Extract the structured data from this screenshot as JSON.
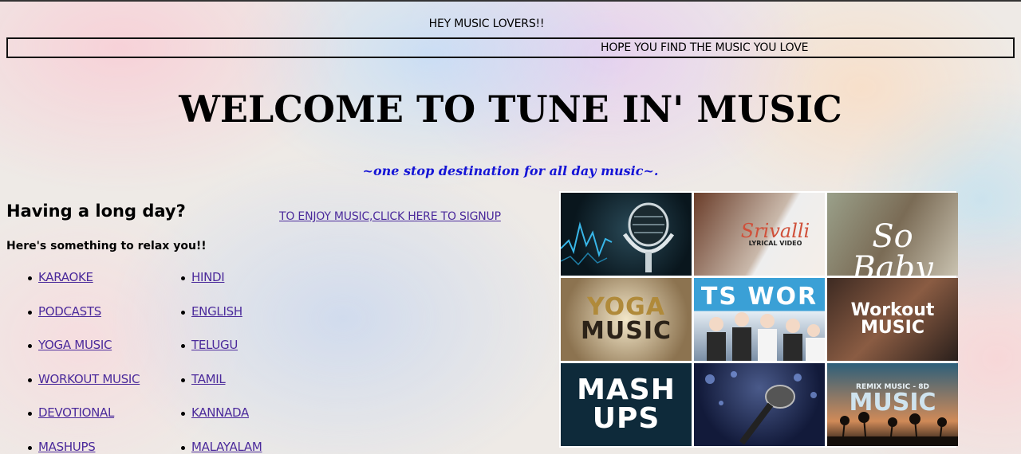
{
  "header": {
    "greeting": "HEY MUSIC LOVERS!!",
    "marquee": "HOPE YOU FIND THE MUSIC YOU LOVE"
  },
  "hero": {
    "title": "WELCOME TO TUNE IN' MUSIC",
    "tagline": "~one stop destination for all day music~."
  },
  "intro": {
    "heading": "Having a long day?",
    "subheading": "Here's something to relax you!!"
  },
  "signup": {
    "link_label": "TO ENJOY MUSIC,CLICK HERE TO SIGNUP"
  },
  "categories": {
    "genres": [
      "KARAOKE",
      "PODCASTS",
      "YOGA MUSIC",
      "WORKOUT MUSIC",
      "DEVOTIONAL",
      "MASHUPS"
    ],
    "languages": [
      "HINDI",
      "ENGLISH",
      "TELUGU",
      "TAMIL",
      "KANNADA",
      "MALAYALAM"
    ]
  },
  "gallery": {
    "srivalli_title": "Srivalli",
    "srivalli_sub": "LYRICAL VIDEO",
    "sobaby": "So Baby",
    "yoga_line1": "YOGA",
    "yoga_line2": "MUSIC",
    "bts": "TS WOR",
    "workout_line1": "Workout",
    "workout_line2": "MUSIC",
    "mash_line1": "MASH",
    "mash_line2": "UPS",
    "remix_small": "REMIX MUSIC - 8D",
    "remix_big": "MUSIC"
  },
  "colors": {
    "link": "#4b2a9b",
    "tagline": "#1414d6"
  }
}
